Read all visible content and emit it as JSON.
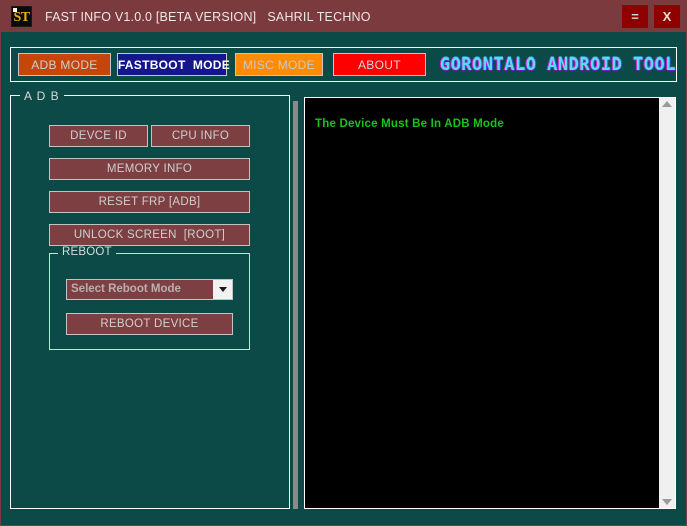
{
  "window": {
    "icon_label": "ST",
    "icon_name": "st-app-icon",
    "title": "FAST INFO V1.0.0 [BETA VERSION]   SAHRIL TECHNO",
    "minimize_label": "=",
    "close_label": "X",
    "titlebar_color": "#7b3b3e",
    "background_color": "#0b4a47"
  },
  "tabs": [
    {
      "label": "ADB MODE",
      "color": "#c5450a",
      "text_color": "#cfcfcf",
      "active": true
    },
    {
      "label": "FASTBOOT  MODE",
      "color": "#15168c",
      "text_color": "#ffffff",
      "active": false
    },
    {
      "label": "MISC MODE",
      "color": "#ff8c00",
      "text_color": "#c8c8c8",
      "active": false
    },
    {
      "label": "ABOUT",
      "color": "#ff0000",
      "text_color": "#d6d6d6",
      "active": false
    }
  ],
  "brand": {
    "text": "GORONTALO ANDROID TOOL",
    "color": "#5fd8f5",
    "shadow_color": "#d01ad0"
  },
  "adb_group": {
    "legend": "A D B",
    "buttons": [
      {
        "label": "DEVCE ID",
        "name": "device-id-button"
      },
      {
        "label": "CPU INFO",
        "name": "cpu-info-button"
      },
      {
        "label": "MEMORY INFO",
        "name": "memory-info-button"
      },
      {
        "label": "RESET FRP [ADB]",
        "name": "reset-frp-button"
      },
      {
        "label": "UNLOCK SCREEN  [ROOT]",
        "name": "unlock-screen-button"
      }
    ],
    "reboot_group": {
      "legend": "REBOOT",
      "combo_value": "Select Reboot Mode",
      "reboot_button_label": "REBOOT DEVICE"
    },
    "button_color": "#7e3f42",
    "button_text_color": "#cfcfcf"
  },
  "log_panel": {
    "lines": [
      "The Device Must Be In ADB Mode"
    ],
    "text_color": "#17c417",
    "background_color": "#000000"
  },
  "scrollbar": {
    "up_arrow": "scroll-up-arrow",
    "down_arrow": "scroll-down-arrow"
  }
}
